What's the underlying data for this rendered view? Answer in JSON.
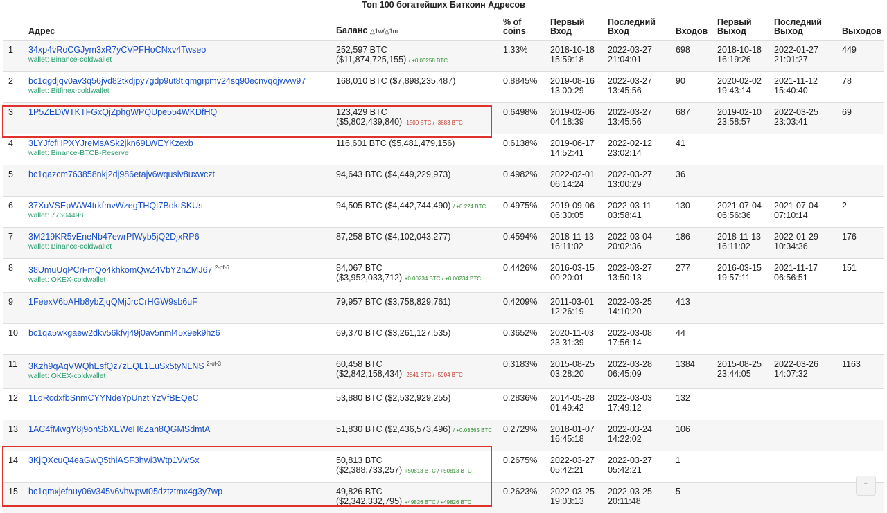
{
  "title": "Топ 100 богатейших Биткоин Адресов",
  "headers": {
    "address": "Адрес",
    "balance": "Баланс",
    "balance_delta": "△1w/△1m",
    "pct": "% of coins",
    "first_in": "Первый Вход",
    "last_in": "Последний Вход",
    "ins": "Входов",
    "first_out": "Первый Выход",
    "last_out": "Последний Выход",
    "outs": "Выходов"
  },
  "rows": [
    {
      "n": "1",
      "address": "34xp4vRoCGJym3xR7yCVPFHoCNxv4Twseo",
      "multisig": "",
      "wallet": "wallet: Binance-coldwallet",
      "btc": "252,597 BTC",
      "usd": "($11,874,725,155)",
      "delta": "/ +0.00258 BTC",
      "delta_sign": "pos",
      "wrap": true,
      "pct": "1.33%",
      "first_in": "2018-10-18 15:59:18",
      "last_in": "2022-03-27 21:04:01",
      "ins": "698",
      "first_out": "2018-10-18 16:19:26",
      "last_out": "2022-01-27 21:01:27",
      "outs": "449"
    },
    {
      "n": "2",
      "address": "bc1qgdjqv0av3q56jvd82tkdjpy7gdp9ut8tlqmgrpmv24sq90ecnvqqjwvw97",
      "multisig": "",
      "wallet": "wallet: Bitfinex-coldwallet",
      "btc": "168,010 BTC",
      "usd": "($7,898,235,487)",
      "delta": "",
      "delta_sign": "",
      "wrap": false,
      "pct": "0.8845%",
      "first_in": "2019-08-16 13:00:29",
      "last_in": "2022-03-27 13:45:56",
      "ins": "90",
      "first_out": "2020-02-02 19:43:14",
      "last_out": "2021-11-12 15:40:40",
      "outs": "78"
    },
    {
      "n": "3",
      "address": "1P5ZEDWTKTFGxQjZphgWPQUpe554WKDfHQ",
      "multisig": "",
      "wallet": "",
      "btc": "123,429 BTC",
      "usd": "($5,802,439,840)",
      "delta": "-1500 BTC / -3683 BTC",
      "delta_sign": "neg",
      "wrap": true,
      "pct": "0.6498%",
      "first_in": "2019-02-06 04:18:39",
      "last_in": "2022-03-27 13:45:56",
      "ins": "687",
      "first_out": "2019-02-10 23:58:57",
      "last_out": "2022-03-25 23:03:41",
      "outs": "69"
    },
    {
      "n": "4",
      "address": "3LYJfcfHPXYJreMsASk2jkn69LWEYKzexb",
      "multisig": "",
      "wallet": "wallet: Binance-BTCB-Reserve",
      "btc": "116,601 BTC",
      "usd": "($5,481,479,156)",
      "delta": "",
      "delta_sign": "",
      "wrap": false,
      "pct": "0.6138%",
      "first_in": "2019-06-17 14:52:41",
      "last_in": "2022-02-12 23:02:14",
      "ins": "41",
      "first_out": "",
      "last_out": "",
      "outs": ""
    },
    {
      "n": "5",
      "address": "bc1qazcm763858nkj2dj986etajv6wquslv8uxwczt",
      "multisig": "",
      "wallet": "",
      "btc": "94,643 BTC",
      "usd": "($4,449,229,973)",
      "delta": "",
      "delta_sign": "",
      "wrap": false,
      "pct": "0.4982%",
      "first_in": "2022-02-01 06:14:24",
      "last_in": "2022-03-27 13:00:29",
      "ins": "36",
      "first_out": "",
      "last_out": "",
      "outs": ""
    },
    {
      "n": "6",
      "address": "37XuVSEpWW4trkfmvWzegTHQt7BdktSKUs",
      "multisig": "",
      "wallet": "wallet: 77604498",
      "btc": "94,505 BTC",
      "usd": "($4,442,744,490)",
      "delta": "/ +0.224 BTC",
      "delta_sign": "pos",
      "wrap": false,
      "pct": "0.4975%",
      "first_in": "2019-09-06 06:30:05",
      "last_in": "2022-03-11 03:58:41",
      "ins": "130",
      "first_out": "2021-07-04 06:56:36",
      "last_out": "2021-07-04 07:10:14",
      "outs": "2"
    },
    {
      "n": "7",
      "address": "3M219KR5vEneNb47ewrPfWyb5jQ2DjxRP6",
      "multisig": "",
      "wallet": "wallet: Binance-coldwallet",
      "btc": "87,258 BTC",
      "usd": "($4,102,043,277)",
      "delta": "",
      "delta_sign": "",
      "wrap": false,
      "pct": "0.4594%",
      "first_in": "2018-11-13 16:11:02",
      "last_in": "2022-03-04 20:02:36",
      "ins": "186",
      "first_out": "2018-11-13 16:11:02",
      "last_out": "2022-01-29 10:34:36",
      "outs": "176"
    },
    {
      "n": "8",
      "address": "38UmuUqPCrFmQo4khkomQwZ4VbY2nZMJ67",
      "multisig": "2-of-6",
      "wallet": "wallet: OKEX-coldwallet",
      "btc": "84,067 BTC",
      "usd": "($3,952,033,712)",
      "delta": "+0.00234 BTC / +0.00234 BTC",
      "delta_sign": "pos",
      "wrap": true,
      "pct": "0.4426%",
      "first_in": "2016-03-15 00:20:01",
      "last_in": "2022-03-27 13:50:13",
      "ins": "277",
      "first_out": "2016-03-15 19:57:11",
      "last_out": "2021-11-17 06:56:51",
      "outs": "151"
    },
    {
      "n": "9",
      "address": "1FeexV6bAHb8ybZjqQMjJrcCrHGW9sb6uF",
      "multisig": "",
      "wallet": "",
      "btc": "79,957 BTC",
      "usd": "($3,758,829,761)",
      "delta": "",
      "delta_sign": "",
      "wrap": false,
      "pct": "0.4209%",
      "first_in": "2011-03-01 12:26:19",
      "last_in": "2022-03-25 14:10:20",
      "ins": "413",
      "first_out": "",
      "last_out": "",
      "outs": ""
    },
    {
      "n": "10",
      "address": "bc1qa5wkgaew2dkv56kfvj49j0av5nml45x9ek9hz6",
      "multisig": "",
      "wallet": "",
      "btc": "69,370 BTC",
      "usd": "($3,261,127,535)",
      "delta": "",
      "delta_sign": "",
      "wrap": false,
      "pct": "0.3652%",
      "first_in": "2020-11-03 23:31:39",
      "last_in": "2022-03-08 17:56:14",
      "ins": "44",
      "first_out": "",
      "last_out": "",
      "outs": ""
    },
    {
      "n": "11",
      "address": "3Kzh9qAqVWQhEsfQz7zEQL1EuSx5tyNLNS",
      "multisig": "2-of-3",
      "wallet": "wallet: OKEX-coldwallet",
      "btc": "60,458 BTC",
      "usd": "($2,842,158,434)",
      "delta": "-2841 BTC / -5904 BTC",
      "delta_sign": "neg",
      "wrap": true,
      "pct": "0.3183%",
      "first_in": "2015-08-25 03:28:20",
      "last_in": "2022-03-28 06:45:09",
      "ins": "1384",
      "first_out": "2015-08-25 23:44:05",
      "last_out": "2022-03-26 14:07:32",
      "outs": "1163"
    },
    {
      "n": "12",
      "address": "1LdRcdxfbSnmCYYNdeYpUnztiYzVfBEQeC",
      "multisig": "",
      "wallet": "",
      "btc": "53,880 BTC",
      "usd": "($2,532,929,255)",
      "delta": "",
      "delta_sign": "",
      "wrap": false,
      "pct": "0.2836%",
      "first_in": "2014-05-28 01:49:42",
      "last_in": "2022-03-03 17:49:12",
      "ins": "132",
      "first_out": "",
      "last_out": "",
      "outs": ""
    },
    {
      "n": "13",
      "address": "1AC4fMwgY8j9onSbXEWeH6Zan8QGMSdmtA",
      "multisig": "",
      "wallet": "",
      "btc": "51,830 BTC",
      "usd": "($2,436,573,496)",
      "delta": "/ +0.03665 BTC",
      "delta_sign": "pos",
      "wrap": false,
      "pct": "0.2729%",
      "first_in": "2018-01-07 16:45:18",
      "last_in": "2022-03-24 14:22:02",
      "ins": "106",
      "first_out": "",
      "last_out": "",
      "outs": ""
    },
    {
      "n": "14",
      "address": "3KjQXcuQ4eaGwQ5thiASF3hwi3Wtp1VwSx",
      "multisig": "",
      "wallet": "",
      "btc": "50,813 BTC",
      "usd": "($2,388,733,257)",
      "delta": "+50813 BTC / +50813 BTC",
      "delta_sign": "pos",
      "wrap": true,
      "pct": "0.2675%",
      "first_in": "2022-03-27 05:42:21",
      "last_in": "2022-03-27 05:42:21",
      "ins": "1",
      "first_out": "",
      "last_out": "",
      "outs": ""
    },
    {
      "n": "15",
      "address": "bc1qmxjefnuy06v345v6vhwpwt05dztztmx4g3y7wp",
      "multisig": "",
      "wallet": "",
      "btc": "49,826 BTC",
      "usd": "($2,342,332,795)",
      "delta": "+49826 BTC / +49826 BTC",
      "delta_sign": "pos",
      "wrap": true,
      "pct": "0.2623%",
      "first_in": "2022-03-25 19:03:13",
      "last_in": "2022-03-25 20:11:48",
      "ins": "5",
      "first_out": "",
      "last_out": "",
      "outs": ""
    }
  ],
  "scroll_top_icon": "arrow-up-icon",
  "scroll_top_glyph": "↑",
  "highlight_color": "#e0322d"
}
